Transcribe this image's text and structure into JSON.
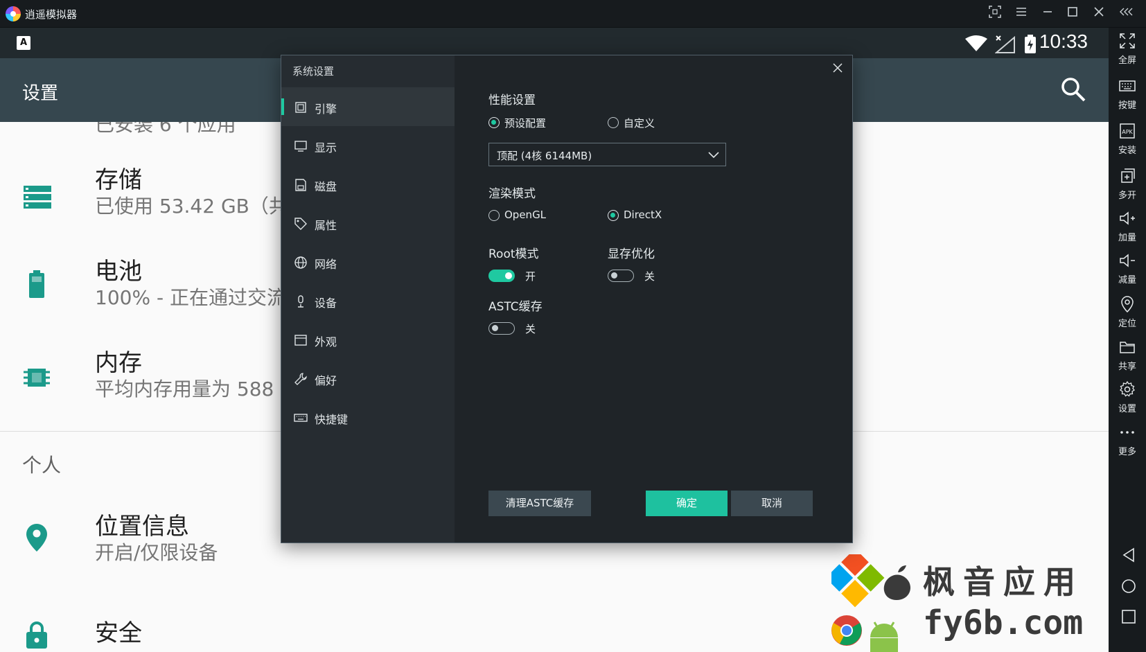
{
  "titlebar": {
    "app_title": "逍遥模拟器"
  },
  "statusbar": {
    "time": "10:33",
    "badge": "A"
  },
  "appbar": {
    "title": "设置"
  },
  "android_settings": {
    "partial_top": "已安装 6 个应用",
    "items": [
      {
        "title": "存储",
        "subtitle": "已使用 53.42 GB（共"
      },
      {
        "title": "电池",
        "subtitle": "100% - 正在通过交流"
      },
      {
        "title": "内存",
        "subtitle": "平均内存用量为 588"
      },
      {
        "title": "位置信息",
        "subtitle": "开启/仅限设备"
      },
      {
        "title": "安全",
        "subtitle": ""
      }
    ],
    "section_personal": "个人"
  },
  "right_toolbar": [
    {
      "label": "全屏",
      "icon": "fullscreen-icon"
    },
    {
      "label": "按键",
      "icon": "keyboard-icon"
    },
    {
      "label": "安装",
      "icon": "apk-icon"
    },
    {
      "label": "多开",
      "icon": "multi-instance-icon"
    },
    {
      "label": "加量",
      "icon": "volume-up-icon"
    },
    {
      "label": "减量",
      "icon": "volume-down-icon"
    },
    {
      "label": "定位",
      "icon": "location-icon"
    },
    {
      "label": "共享",
      "icon": "folder-icon"
    },
    {
      "label": "设置",
      "icon": "gear-icon"
    },
    {
      "label": "更多",
      "icon": "more-icon"
    }
  ],
  "dialog": {
    "title": "系统设置",
    "nav": [
      {
        "label": "引擎",
        "active": true
      },
      {
        "label": "显示",
        "active": false
      },
      {
        "label": "磁盘",
        "active": false
      },
      {
        "label": "属性",
        "active": false
      },
      {
        "label": "网络",
        "active": false
      },
      {
        "label": "设备",
        "active": false
      },
      {
        "label": "外观",
        "active": false
      },
      {
        "label": "偏好",
        "active": false
      },
      {
        "label": "快捷键",
        "active": false
      }
    ],
    "performance": {
      "title": "性能设置",
      "option_preset": "预设配置",
      "option_custom": "自定义",
      "selected": "预设配置",
      "preset_value": "顶配 (4核 6144MB)"
    },
    "render": {
      "title": "渲染模式",
      "option_opengl": "OpenGL",
      "option_directx": "DirectX",
      "selected": "DirectX"
    },
    "root_mode": {
      "title": "Root模式",
      "state_label": "开",
      "on": true
    },
    "vram_opt": {
      "title": "显存优化",
      "state_label": "关",
      "on": false
    },
    "astc_cache": {
      "title": "ASTC缓存",
      "state_label": "关",
      "on": false
    },
    "buttons": {
      "clear_astc": "清理ASTC缓存",
      "confirm": "确定",
      "cancel": "取消"
    }
  },
  "watermark": {
    "line1": "枫音应用",
    "line2": "fy6b.com"
  },
  "colors": {
    "accent": "#1fc9a1",
    "appbar": "#36474f",
    "dialog_bg": "#1f2428",
    "dialog_side": "#262c31",
    "android_icon": "#1b9a8a"
  }
}
